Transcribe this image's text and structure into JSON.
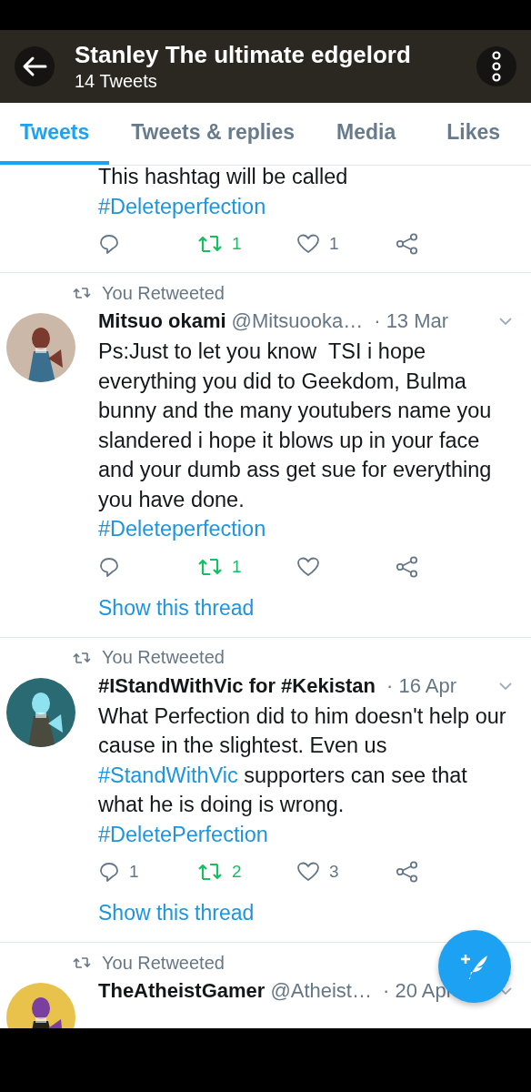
{
  "header": {
    "title": "Stanley The ultimate edgelord",
    "subtitle": "14 Tweets"
  },
  "tabs": [
    {
      "label": "Tweets",
      "selected": true
    },
    {
      "label": "Tweets & replies",
      "selected": false
    },
    {
      "label": "Media",
      "selected": false
    },
    {
      "label": "Likes",
      "selected": false
    }
  ],
  "tweets": [
    {
      "body": [
        {
          "kind": "text",
          "text": "This hashtag will be called"
        }
      ],
      "hashtag_line": "#Deleteperfection",
      "actions": {
        "retweet": {
          "count": "1",
          "active": true
        },
        "like": {
          "count": "1",
          "active": false
        }
      }
    },
    {
      "retweeted_by": "You Retweeted",
      "name": "Mitsuo okami",
      "handle": "@Mitsuooka…",
      "time": "· 13 Mar",
      "body": [
        {
          "kind": "text",
          "text": "Ps:Just to let you know  TSI i hope everything you did to Geekdom, Bulma bunny and the many youtubers name you slandered i hope it blows up in your face and your dumb ass get sue for everything you have done."
        }
      ],
      "hashtag_line": "#Deleteperfection",
      "actions": {
        "retweet": {
          "count": "1",
          "active": true
        },
        "like": {
          "active": false
        }
      },
      "show_thread": "Show this thread"
    },
    {
      "retweeted_by": "You Retweeted",
      "name": "#IStandWithVic for #Kekistan",
      "time": "· 16 Apr",
      "body": [
        {
          "kind": "text",
          "text": "What Perfection did to him doesn't help our cause in the slightest. Even us "
        },
        {
          "kind": "hashtag",
          "text": "#StandWithVic"
        },
        {
          "kind": "text",
          "text": " supporters can see that what he is doing is wrong."
        }
      ],
      "hashtag_line": "#DeletePerfection",
      "actions": {
        "reply": {
          "count": "1"
        },
        "retweet": {
          "count": "2",
          "active": true
        },
        "like": {
          "count": "3",
          "active": false
        }
      },
      "show_thread": "Show this thread"
    },
    {
      "retweeted_by": "You Retweeted",
      "name": "TheAtheistGamer",
      "handle": "@Atheist…",
      "time": "· 20 Apr"
    }
  ]
}
